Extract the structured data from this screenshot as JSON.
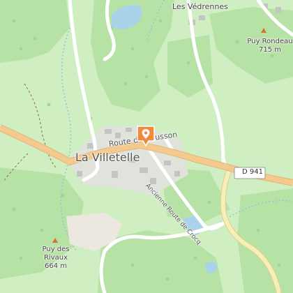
{
  "map": {
    "places": {
      "town": "La Villetelle",
      "hamlet_ne": "Les Védrennes"
    },
    "peaks": {
      "peak_ne": {
        "name": "Puy Rondeau",
        "elevation": "715 m"
      },
      "peak_sw": {
        "name_line1": "Puy des",
        "name_line2": "Rivaux",
        "elevation": "664 m"
      }
    },
    "roads": {
      "main_road": "Route d'Aubusson",
      "side_road": "Ancienne Route de Crocq",
      "route_badge": "D 941"
    },
    "marker_icon": "location-pin-icon",
    "colors": {
      "forest": "#b7e2a6",
      "meadow": "#cfeec1",
      "water": "#a9d3e8",
      "main_road": "#f3c98d",
      "route_yellow": "#f7f0b6",
      "marker": "#f08a3c"
    }
  }
}
